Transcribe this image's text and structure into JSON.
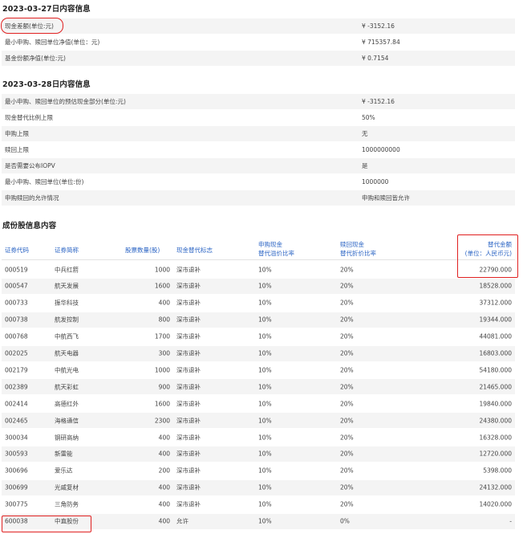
{
  "sec1": {
    "title": "2023-03-27日内容信息",
    "rows": [
      {
        "k": "现金差额(单位:元)",
        "v": "¥ -3152.16"
      },
      {
        "k": "最小申购、赎回单位净值(单位：元)",
        "v": "¥ 715357.84"
      },
      {
        "k": "基金份额净值(单位:元)",
        "v": "¥ 0.7154"
      }
    ]
  },
  "sec2": {
    "title": "2023-03-28日内容信息",
    "rows": [
      {
        "k": "最小申购、赎回单位的预估现金部分(单位:元)",
        "v": "¥ -3152.16"
      },
      {
        "k": "现金替代比例上限",
        "v": "50%"
      },
      {
        "k": "申购上限",
        "v": "无"
      },
      {
        "k": "赎回上限",
        "v": "1000000000"
      },
      {
        "k": "是否需要公布IOPV",
        "v": "是"
      },
      {
        "k": "最小申购、赎回单位(单位:份)",
        "v": "1000000"
      },
      {
        "k": "申购赎回的允许情况",
        "v": "申购和赎回皆允许"
      }
    ]
  },
  "sec3": {
    "title": "成份股信息内容",
    "headers": {
      "code": "证券代码",
      "name": "证券简称",
      "qty": "股票数量(股)",
      "flag": "现金替代标志",
      "sub_l1": "申购现金",
      "sub_l2": "替代溢价比率",
      "red_l1": "赎回现金",
      "red_l2": "替代折价比率",
      "amt_l1": "替代金额",
      "amt_l2": "(单位：人民币元)"
    },
    "rows": [
      {
        "code": "000519",
        "name": "中兵红箭",
        "qty": "1000",
        "flag": "深市退补",
        "sub": "10%",
        "red": "20%",
        "amt": "22790.000"
      },
      {
        "code": "000547",
        "name": "航天发展",
        "qty": "1600",
        "flag": "深市退补",
        "sub": "10%",
        "red": "20%",
        "amt": "18528.000"
      },
      {
        "code": "000733",
        "name": "振华科技",
        "qty": "400",
        "flag": "深市退补",
        "sub": "10%",
        "red": "20%",
        "amt": "37312.000"
      },
      {
        "code": "000738",
        "name": "航发控制",
        "qty": "800",
        "flag": "深市退补",
        "sub": "10%",
        "red": "20%",
        "amt": "19344.000"
      },
      {
        "code": "000768",
        "name": "中航西飞",
        "qty": "1700",
        "flag": "深市退补",
        "sub": "10%",
        "red": "20%",
        "amt": "44081.000"
      },
      {
        "code": "002025",
        "name": "航天电器",
        "qty": "300",
        "flag": "深市退补",
        "sub": "10%",
        "red": "20%",
        "amt": "16803.000"
      },
      {
        "code": "002179",
        "name": "中航光电",
        "qty": "1000",
        "flag": "深市退补",
        "sub": "10%",
        "red": "20%",
        "amt": "54180.000"
      },
      {
        "code": "002389",
        "name": "航天彩虹",
        "qty": "900",
        "flag": "深市退补",
        "sub": "10%",
        "red": "20%",
        "amt": "21465.000"
      },
      {
        "code": "002414",
        "name": "高德红外",
        "qty": "1600",
        "flag": "深市退补",
        "sub": "10%",
        "red": "20%",
        "amt": "19840.000"
      },
      {
        "code": "002465",
        "name": "海格通信",
        "qty": "2300",
        "flag": "深市退补",
        "sub": "10%",
        "red": "20%",
        "amt": "24380.000"
      },
      {
        "code": "300034",
        "name": "钢研高纳",
        "qty": "400",
        "flag": "深市退补",
        "sub": "10%",
        "red": "20%",
        "amt": "16328.000"
      },
      {
        "code": "300593",
        "name": "新雷能",
        "qty": "400",
        "flag": "深市退补",
        "sub": "10%",
        "red": "20%",
        "amt": "12720.000"
      },
      {
        "code": "300696",
        "name": "爱乐达",
        "qty": "200",
        "flag": "深市退补",
        "sub": "10%",
        "red": "20%",
        "amt": "5398.000"
      },
      {
        "code": "300699",
        "name": "光威复材",
        "qty": "400",
        "flag": "深市退补",
        "sub": "10%",
        "red": "20%",
        "amt": "24132.000"
      },
      {
        "code": "300775",
        "name": "三角防务",
        "qty": "400",
        "flag": "深市退补",
        "sub": "10%",
        "red": "20%",
        "amt": "14020.000"
      },
      {
        "code": "600038",
        "name": "中直股份",
        "qty": "400",
        "flag": "允许",
        "sub": "10%",
        "red": "0%",
        "amt": "-"
      }
    ]
  },
  "colors": {
    "header_blue": "#2b64c4",
    "highlight_red": "#e02020",
    "stripe": "#f4f4f4"
  }
}
